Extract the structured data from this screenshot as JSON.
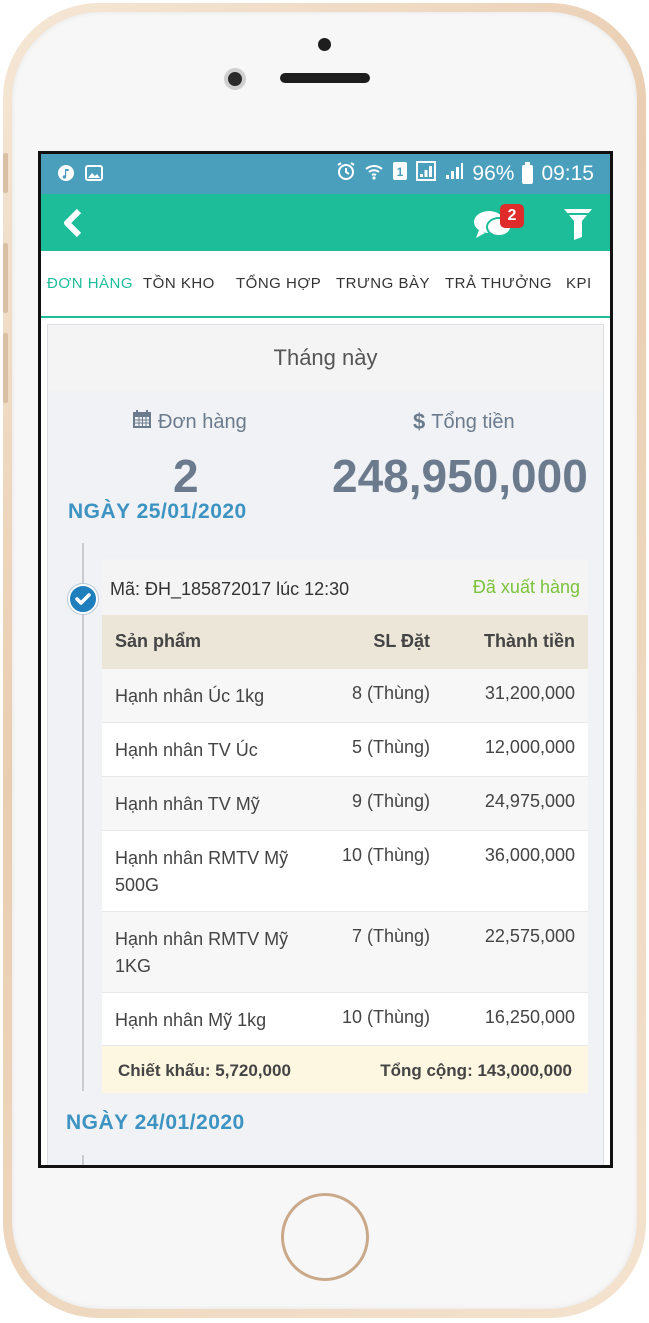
{
  "status_bar": {
    "battery": "96%",
    "time": "09:15"
  },
  "app_bar": {
    "chat_badge": "2"
  },
  "tabs": [
    {
      "label": "ĐƠN HÀNG",
      "active": true
    },
    {
      "label": "TỒN KHO",
      "active": false
    },
    {
      "label": "TỔNG HỢP",
      "active": false
    },
    {
      "label": "TRƯNG BÀY",
      "active": false
    },
    {
      "label": "TRẢ THƯỞNG",
      "active": false
    },
    {
      "label": "KPI",
      "active": false
    }
  ],
  "summary": {
    "period": "Tháng này",
    "orders_label": "Đơn hàng",
    "orders_value": "2",
    "total_label": "Tổng tiền",
    "total_value": "248,950,000"
  },
  "days": [
    {
      "date": "NGÀY 25/01/2020",
      "order": {
        "code": "Mã: ĐH_185872017 lúc 12:30",
        "status": "Đã xuất hàng",
        "columns": [
          "Sản phẩm",
          "SL Đặt",
          "Thành tiền"
        ],
        "items": [
          {
            "name": "Hạnh nhân Úc 1kg",
            "qty": "8 (Thùng)",
            "amount": "31,200,000"
          },
          {
            "name": "Hạnh nhân TV Úc",
            "qty": "5 (Thùng)",
            "amount": "12,000,000"
          },
          {
            "name": "Hạnh nhân TV Mỹ",
            "qty": "9 (Thùng)",
            "amount": "24,975,000"
          },
          {
            "name": "Hạnh nhân RMTV Mỹ 500G",
            "qty": "10 (Thùng)",
            "amount": "36,000,000"
          },
          {
            "name": "Hạnh nhân RMTV Mỹ 1KG",
            "qty": "7 (Thùng)",
            "amount": "22,575,000"
          },
          {
            "name": "Hạnh nhân Mỹ 1kg",
            "qty": "10 (Thùng)",
            "amount": "16,250,000"
          }
        ],
        "discount": "Chiết khấu: 5,720,000",
        "total": "Tổng cộng: 143,000,000"
      }
    },
    {
      "date": "NGÀY 24/01/2020"
    }
  ],
  "colors": {
    "primary": "#1dbd9a",
    "status_bar": "#4a9fbd",
    "accent_blue": "#3d93c1",
    "badge": "#e02b2b"
  }
}
